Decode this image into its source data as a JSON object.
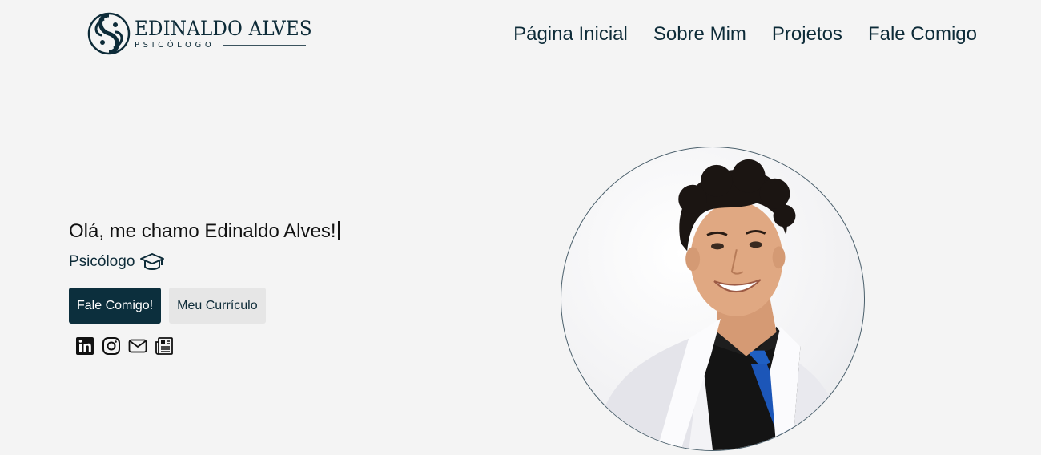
{
  "brand": {
    "name": "EDINALDO ALVES",
    "subtitle": "PSICÓLOGO",
    "logo_icon": "yin-yang-s-icon",
    "color": "#0d2b38"
  },
  "nav": {
    "items": [
      {
        "label": "Página Inicial"
      },
      {
        "label": "Sobre Mim"
      },
      {
        "label": "Projetos"
      },
      {
        "label": "Fale Comigo"
      }
    ]
  },
  "hero": {
    "greeting": "Olá, me chamo Edinaldo Alves!",
    "role": "Psicólogo",
    "role_icon": "graduation-cap-icon",
    "buttons": {
      "primary_label": "Fale Comigo!",
      "secondary_label": "Meu Currículo"
    },
    "social_icons": [
      "linkedin-icon",
      "instagram-icon",
      "mail-icon",
      "newspaper-icon"
    ],
    "primary_color": "#0c2f3d",
    "secondary_color": "#e6e6e6"
  },
  "profile_photo": {
    "subject": "smiling man with curly dark hair in white coat, black shirt and blue tie"
  }
}
